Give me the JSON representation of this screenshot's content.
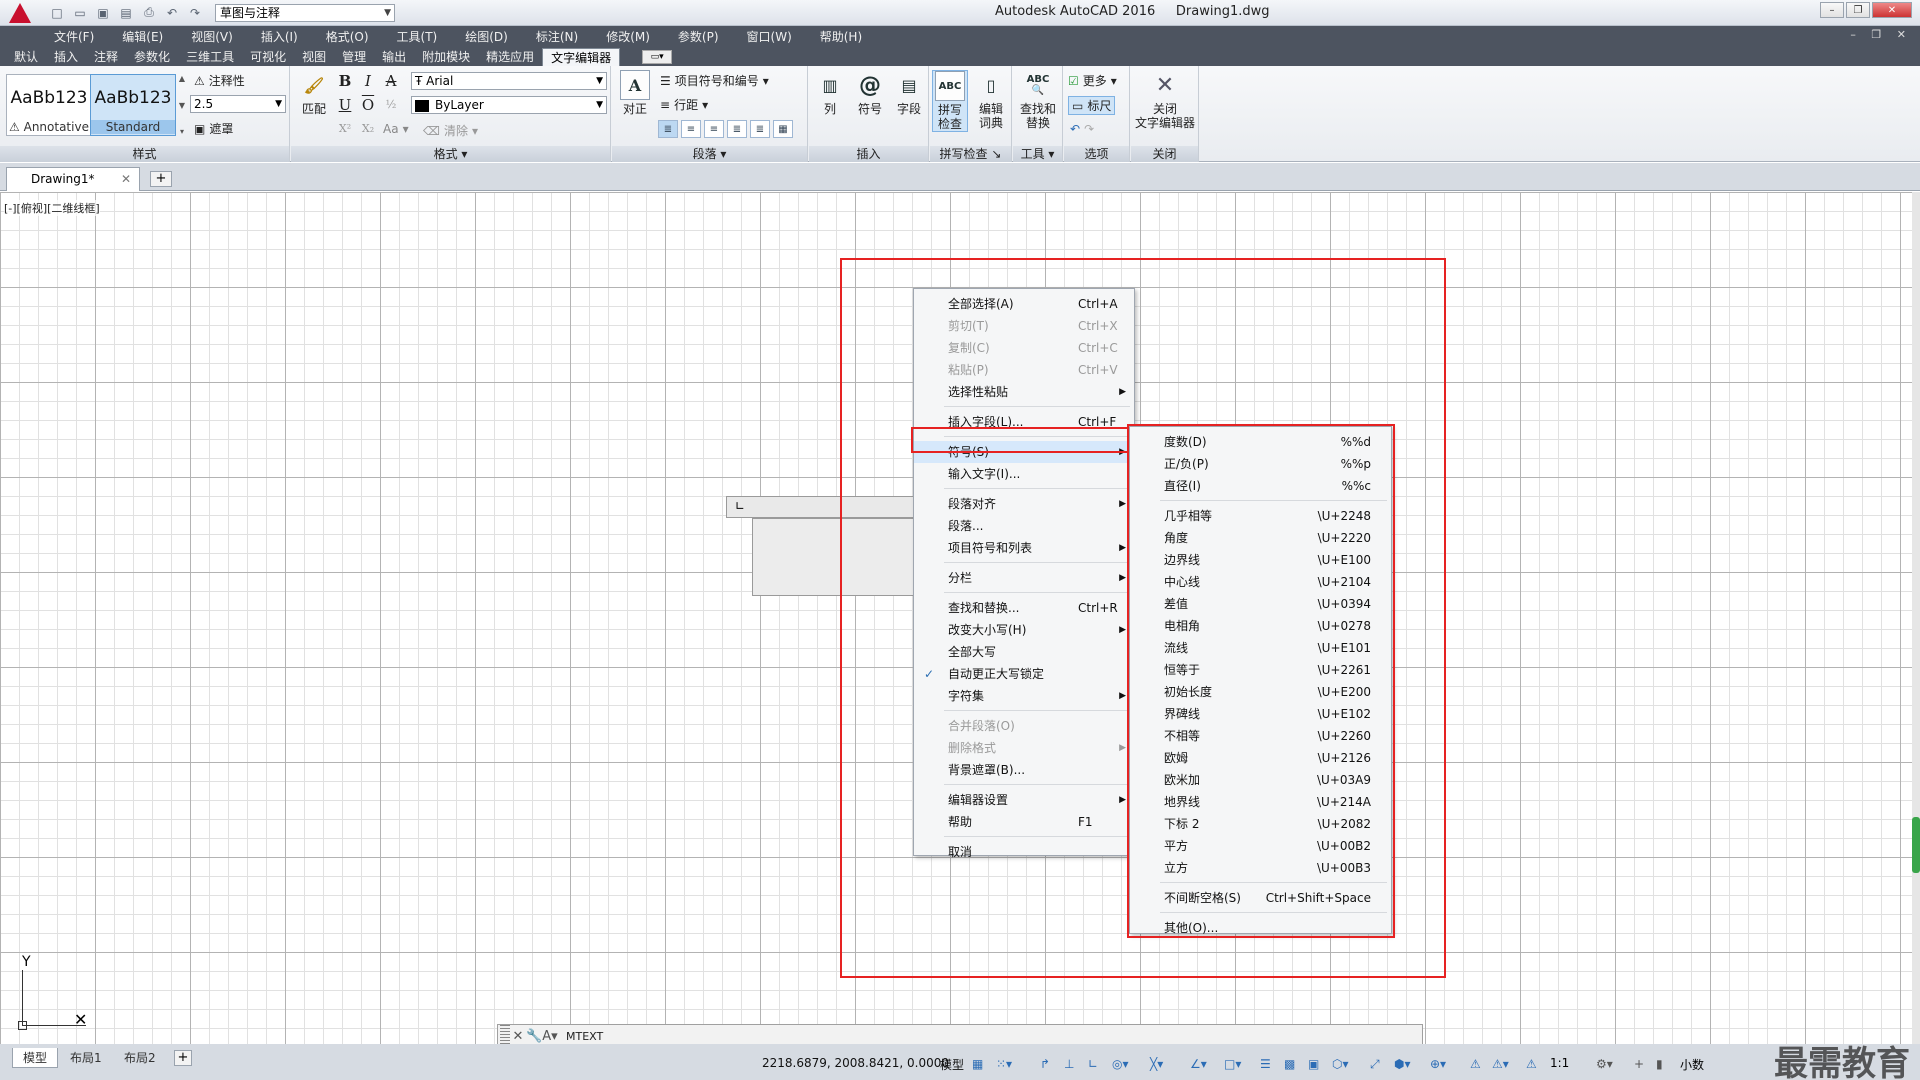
{
  "window": {
    "title": "Autodesk AutoCAD 2016",
    "filename": "Drawing1.dwg",
    "workspace": "草图与注释"
  },
  "menubar": [
    "文件(F)",
    "编辑(E)",
    "视图(V)",
    "插入(I)",
    "格式(O)",
    "工具(T)",
    "绘图(D)",
    "标注(N)",
    "修改(M)",
    "参数(P)",
    "窗口(W)",
    "帮助(H)"
  ],
  "ribbon_tabs": [
    "默认",
    "插入",
    "注释",
    "参数化",
    "三维工具",
    "可视化",
    "视图",
    "管理",
    "输出",
    "附加模块",
    "精选应用",
    "文字编辑器"
  ],
  "ribbon": {
    "style": {
      "title": "样式",
      "sample_text": "AaBb123",
      "style1": "Annotative",
      "style2": "Standard",
      "annotative_label": "注释性",
      "text_height": "2.5",
      "mask_label": "遮罩"
    },
    "format": {
      "title": "格式",
      "match_label": "匹配",
      "font": "Arial",
      "color": "ByLayer",
      "clear_label": "清除",
      "case_label": "Aa"
    },
    "paragraph": {
      "title": "段落",
      "justify_label": "对正",
      "bullets_label": "项目符号和编号",
      "spacing_label": "行距"
    },
    "insert": {
      "title": "插入",
      "column_label": "列",
      "symbol_label": "符号",
      "field_label": "字段"
    },
    "spell": {
      "title": "拼写检查",
      "spell_label": "拼写\n检查",
      "dict_label": "编辑\n词典"
    },
    "tools": {
      "title": "工具",
      "find_label": "查找和\n替换"
    },
    "options": {
      "title": "选项",
      "more_label": "更多",
      "ruler_label": "标尺"
    },
    "close": {
      "title": "关闭",
      "close_label": "关闭\n文字编辑器"
    }
  },
  "doc_tab": "Drawing1*",
  "viewport_label": "[-][俯视][二维线框]",
  "context_menu": [
    {
      "label": "全部选择(A)",
      "shortcut": "Ctrl+A"
    },
    {
      "label": "剪切(T)",
      "shortcut": "Ctrl+X",
      "disabled": true
    },
    {
      "label": "复制(C)",
      "shortcut": "Ctrl+C",
      "disabled": true
    },
    {
      "label": "粘贴(P)",
      "shortcut": "Ctrl+V",
      "disabled": true
    },
    {
      "label": "选择性粘贴",
      "submenu": true
    },
    {
      "label": "插入字段(L)...",
      "shortcut": "Ctrl+F"
    },
    {
      "label": "符号(S)",
      "submenu": true,
      "highlighted": true
    },
    {
      "label": "输入文字(I)..."
    },
    {
      "label": "段落对齐",
      "submenu": true
    },
    {
      "label": "段落..."
    },
    {
      "label": "项目符号和列表",
      "submenu": true
    },
    {
      "label": "分栏",
      "submenu": true
    },
    {
      "label": "查找和替换...",
      "shortcut": "Ctrl+R"
    },
    {
      "label": "改变大小写(H)",
      "submenu": true
    },
    {
      "label": "全部大写"
    },
    {
      "label": "自动更正大写锁定",
      "checked": true
    },
    {
      "label": "字符集",
      "submenu": true
    },
    {
      "label": "合并段落(O)",
      "disabled": true
    },
    {
      "label": "删除格式",
      "submenu": true,
      "disabled": true
    },
    {
      "label": "背景遮罩(B)..."
    },
    {
      "label": "编辑器设置",
      "submenu": true
    },
    {
      "label": "帮助",
      "shortcut": "F1"
    },
    {
      "label": "取消"
    }
  ],
  "symbol_submenu": [
    {
      "label": "度数(D)",
      "code": "%%d"
    },
    {
      "label": "正/负(P)",
      "code": "%%p"
    },
    {
      "label": "直径(I)",
      "code": "%%c"
    },
    {
      "label": "几乎相等",
      "code": "\\U+2248"
    },
    {
      "label": "角度",
      "code": "\\U+2220"
    },
    {
      "label": "边界线",
      "code": "\\U+E100"
    },
    {
      "label": "中心线",
      "code": "\\U+2104"
    },
    {
      "label": "差值",
      "code": "\\U+0394"
    },
    {
      "label": "电相角",
      "code": "\\U+0278"
    },
    {
      "label": "流线",
      "code": "\\U+E101"
    },
    {
      "label": "恒等于",
      "code": "\\U+2261"
    },
    {
      "label": "初始长度",
      "code": "\\U+E200"
    },
    {
      "label": "界碑线",
      "code": "\\U+E102"
    },
    {
      "label": "不相等",
      "code": "\\U+2260"
    },
    {
      "label": "欧姆",
      "code": "\\U+2126"
    },
    {
      "label": "欧米加",
      "code": "\\U+03A9"
    },
    {
      "label": "地界线",
      "code": "\\U+214A"
    },
    {
      "label": "下标 2",
      "code": "\\U+2082"
    },
    {
      "label": "平方",
      "code": "\\U+00B2"
    },
    {
      "label": "立方",
      "code": "\\U+00B3"
    },
    {
      "label": "不间断空格(S)",
      "code": "Ctrl+Shift+Space"
    },
    {
      "label": "其他(O)..."
    }
  ],
  "command_line": "MTEXT",
  "layout_tabs": [
    "模型",
    "布局1",
    "布局2"
  ],
  "status": {
    "coords": "2218.6879, 2008.8421, 0.0000",
    "model": "模型",
    "scale": "1:1",
    "units": "小数"
  },
  "watermark": "最需教育",
  "colors": {
    "accent": "#e62222",
    "highlight": "#d6e8fb",
    "menubar": "#4d5460"
  }
}
